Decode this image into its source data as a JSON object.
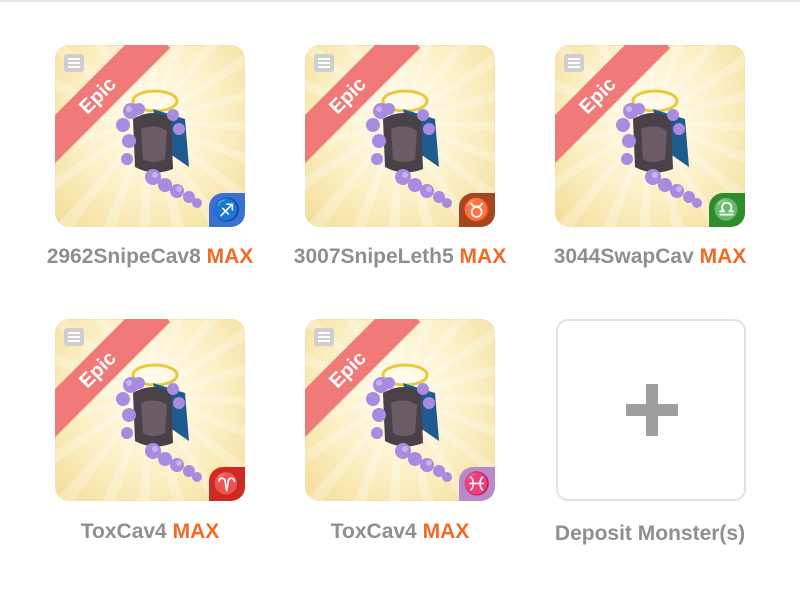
{
  "cards": [
    {
      "name": "2962SnipeCav8",
      "max": "MAX",
      "rarity": "Epic",
      "sign": "♐",
      "sign_color": "#3b70d3"
    },
    {
      "name": "3007SnipeLeth5",
      "max": "MAX",
      "rarity": "Epic",
      "sign": "♉",
      "sign_color": "#a4461e"
    },
    {
      "name": "3044SwapCav",
      "max": "MAX",
      "rarity": "Epic",
      "sign": "♎",
      "sign_color": "#2f8c2c"
    },
    {
      "name": "ToxCav4",
      "max": "MAX",
      "rarity": "Epic",
      "sign": "♈",
      "sign_color": "#cf2a21"
    },
    {
      "name": "ToxCav4",
      "max": "MAX",
      "rarity": "Epic",
      "sign": "♓",
      "sign_color": "#b88ac9"
    }
  ],
  "deposit": {
    "label": "Deposit Monster(s)",
    "icon": "plus-icon"
  },
  "colors": {
    "ribbon": "#f07a78",
    "max": "#f26b24",
    "caption": "#8f8f8f"
  }
}
